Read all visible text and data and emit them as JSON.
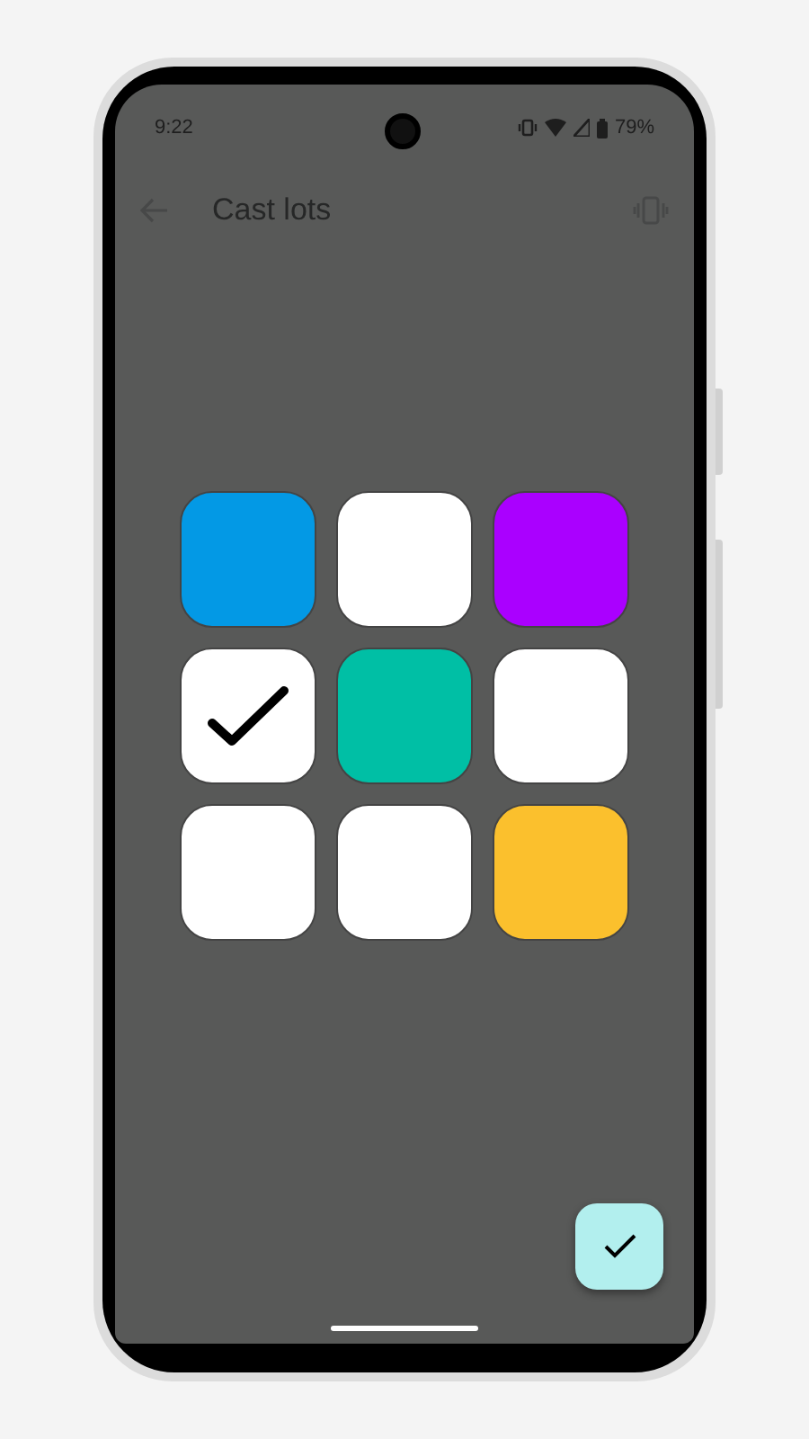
{
  "status_bar": {
    "time": "9:22",
    "battery": "79%"
  },
  "toolbar": {
    "title": "Cast lots"
  },
  "tiles": [
    {
      "color": "#0399e5",
      "checked": false
    },
    {
      "color": "#ffffff",
      "checked": false
    },
    {
      "color": "#aa00ff",
      "checked": false
    },
    {
      "color": "#ffffff",
      "checked": true
    },
    {
      "color": "#00bfa5",
      "checked": false
    },
    {
      "color": "#ffffff",
      "checked": false
    },
    {
      "color": "#ffffff",
      "checked": false
    },
    {
      "color": "#ffffff",
      "checked": false
    },
    {
      "color": "#fbc02d",
      "checked": false
    }
  ],
  "fab": {
    "kind": "confirm"
  }
}
